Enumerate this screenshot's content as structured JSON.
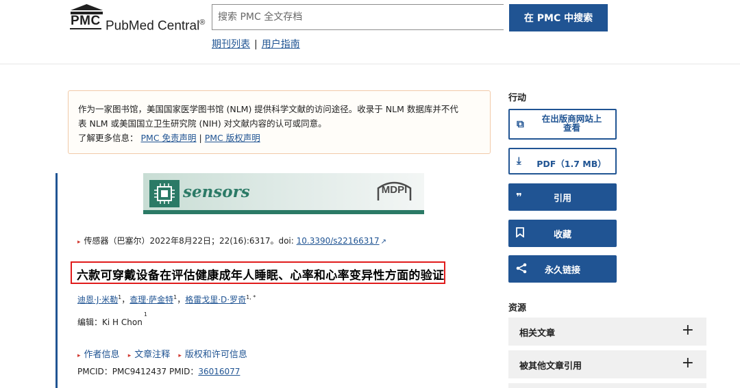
{
  "header": {
    "logo_abbr": "PMC",
    "logo_name": "PubMed Central",
    "logo_reg": "®",
    "search_placeholder": "搜索 PMC 全文存档",
    "search_button": "在 PMC 中搜索",
    "links": [
      "期刊列表",
      "用户指南"
    ],
    "link_separator": "|"
  },
  "disclaimer": {
    "line1": "作为一家图书馆，美国国家医学图书馆 (NLM) 提供科学文献的访问途径。收录于 NLM 数据库并不代",
    "line2": "表 NLM 或美国国立卫生研究院 (NIH) 对文献内容的认可或同意。",
    "learn_more": "了解更多信息：",
    "link1": "PMC 免责声明",
    "separator": "|",
    "link2": "PMC 版权声明"
  },
  "article": {
    "banner": {
      "journal": "sensors",
      "publisher": "MDPI"
    },
    "citation": {
      "prefix": "传感器（巴塞尔）2022年8月22日；22(16):6317。doi: ",
      "doi": "10.3390/s22166317"
    },
    "title": "六款可穿戴设备在评估健康成年人睡眠、心率和心率变异性方面的验证",
    "authors": [
      {
        "name": "迪恩·J·米勒",
        "sup": "1",
        "sep": "，"
      },
      {
        "name": "查理·萨金特",
        "sup": "1",
        "sep": "，"
      },
      {
        "name": "格雷戈里·D·罗奇",
        "sup": "1, *",
        "sep": ""
      }
    ],
    "editor_label": "编辑：",
    "editor_name": "Ki H Chon",
    "editor_sup": "1",
    "info_links": [
      "作者信息",
      "文章注释",
      "版权和许可信息"
    ],
    "ids": {
      "pmcid_text": "PMCID：PMC9412437 PMID：",
      "pmid": "36016077"
    }
  },
  "sidebar": {
    "actions_heading": "行动",
    "publisher_site_line1": "在出版商网站上",
    "publisher_site_line2": "查看",
    "pdf": "PDF（1.7 MB）",
    "cite": "引用",
    "collections": "收藏",
    "permalink": "永久链接",
    "resources_heading": "资源",
    "resources": [
      "相关文章",
      "被其他文章引用"
    ],
    "expand_symbol": "+"
  },
  "colors": {
    "primary": "#205493",
    "title_highlight": "#e01a1a",
    "disclaimer_border": "#f1c9a8",
    "accent_triangle": "#d1382f"
  }
}
